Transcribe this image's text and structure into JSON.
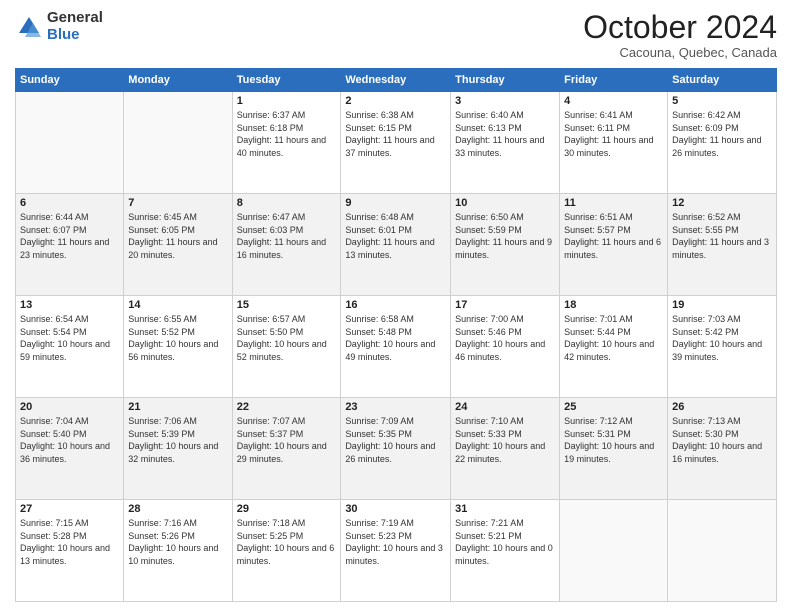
{
  "logo": {
    "general": "General",
    "blue": "Blue"
  },
  "title": "October 2024",
  "subtitle": "Cacouna, Quebec, Canada",
  "headers": [
    "Sunday",
    "Monday",
    "Tuesday",
    "Wednesday",
    "Thursday",
    "Friday",
    "Saturday"
  ],
  "weeks": [
    [
      {
        "day": "",
        "info": ""
      },
      {
        "day": "",
        "info": ""
      },
      {
        "day": "1",
        "info": "Sunrise: 6:37 AM\nSunset: 6:18 PM\nDaylight: 11 hours and 40 minutes."
      },
      {
        "day": "2",
        "info": "Sunrise: 6:38 AM\nSunset: 6:15 PM\nDaylight: 11 hours and 37 minutes."
      },
      {
        "day": "3",
        "info": "Sunrise: 6:40 AM\nSunset: 6:13 PM\nDaylight: 11 hours and 33 minutes."
      },
      {
        "day": "4",
        "info": "Sunrise: 6:41 AM\nSunset: 6:11 PM\nDaylight: 11 hours and 30 minutes."
      },
      {
        "day": "5",
        "info": "Sunrise: 6:42 AM\nSunset: 6:09 PM\nDaylight: 11 hours and 26 minutes."
      }
    ],
    [
      {
        "day": "6",
        "info": "Sunrise: 6:44 AM\nSunset: 6:07 PM\nDaylight: 11 hours and 23 minutes."
      },
      {
        "day": "7",
        "info": "Sunrise: 6:45 AM\nSunset: 6:05 PM\nDaylight: 11 hours and 20 minutes."
      },
      {
        "day": "8",
        "info": "Sunrise: 6:47 AM\nSunset: 6:03 PM\nDaylight: 11 hours and 16 minutes."
      },
      {
        "day": "9",
        "info": "Sunrise: 6:48 AM\nSunset: 6:01 PM\nDaylight: 11 hours and 13 minutes."
      },
      {
        "day": "10",
        "info": "Sunrise: 6:50 AM\nSunset: 5:59 PM\nDaylight: 11 hours and 9 minutes."
      },
      {
        "day": "11",
        "info": "Sunrise: 6:51 AM\nSunset: 5:57 PM\nDaylight: 11 hours and 6 minutes."
      },
      {
        "day": "12",
        "info": "Sunrise: 6:52 AM\nSunset: 5:55 PM\nDaylight: 11 hours and 3 minutes."
      }
    ],
    [
      {
        "day": "13",
        "info": "Sunrise: 6:54 AM\nSunset: 5:54 PM\nDaylight: 10 hours and 59 minutes."
      },
      {
        "day": "14",
        "info": "Sunrise: 6:55 AM\nSunset: 5:52 PM\nDaylight: 10 hours and 56 minutes."
      },
      {
        "day": "15",
        "info": "Sunrise: 6:57 AM\nSunset: 5:50 PM\nDaylight: 10 hours and 52 minutes."
      },
      {
        "day": "16",
        "info": "Sunrise: 6:58 AM\nSunset: 5:48 PM\nDaylight: 10 hours and 49 minutes."
      },
      {
        "day": "17",
        "info": "Sunrise: 7:00 AM\nSunset: 5:46 PM\nDaylight: 10 hours and 46 minutes."
      },
      {
        "day": "18",
        "info": "Sunrise: 7:01 AM\nSunset: 5:44 PM\nDaylight: 10 hours and 42 minutes."
      },
      {
        "day": "19",
        "info": "Sunrise: 7:03 AM\nSunset: 5:42 PM\nDaylight: 10 hours and 39 minutes."
      }
    ],
    [
      {
        "day": "20",
        "info": "Sunrise: 7:04 AM\nSunset: 5:40 PM\nDaylight: 10 hours and 36 minutes."
      },
      {
        "day": "21",
        "info": "Sunrise: 7:06 AM\nSunset: 5:39 PM\nDaylight: 10 hours and 32 minutes."
      },
      {
        "day": "22",
        "info": "Sunrise: 7:07 AM\nSunset: 5:37 PM\nDaylight: 10 hours and 29 minutes."
      },
      {
        "day": "23",
        "info": "Sunrise: 7:09 AM\nSunset: 5:35 PM\nDaylight: 10 hours and 26 minutes."
      },
      {
        "day": "24",
        "info": "Sunrise: 7:10 AM\nSunset: 5:33 PM\nDaylight: 10 hours and 22 minutes."
      },
      {
        "day": "25",
        "info": "Sunrise: 7:12 AM\nSunset: 5:31 PM\nDaylight: 10 hours and 19 minutes."
      },
      {
        "day": "26",
        "info": "Sunrise: 7:13 AM\nSunset: 5:30 PM\nDaylight: 10 hours and 16 minutes."
      }
    ],
    [
      {
        "day": "27",
        "info": "Sunrise: 7:15 AM\nSunset: 5:28 PM\nDaylight: 10 hours and 13 minutes."
      },
      {
        "day": "28",
        "info": "Sunrise: 7:16 AM\nSunset: 5:26 PM\nDaylight: 10 hours and 10 minutes."
      },
      {
        "day": "29",
        "info": "Sunrise: 7:18 AM\nSunset: 5:25 PM\nDaylight: 10 hours and 6 minutes."
      },
      {
        "day": "30",
        "info": "Sunrise: 7:19 AM\nSunset: 5:23 PM\nDaylight: 10 hours and 3 minutes."
      },
      {
        "day": "31",
        "info": "Sunrise: 7:21 AM\nSunset: 5:21 PM\nDaylight: 10 hours and 0 minutes."
      },
      {
        "day": "",
        "info": ""
      },
      {
        "day": "",
        "info": ""
      }
    ]
  ],
  "shaded_rows": [
    1,
    3
  ]
}
